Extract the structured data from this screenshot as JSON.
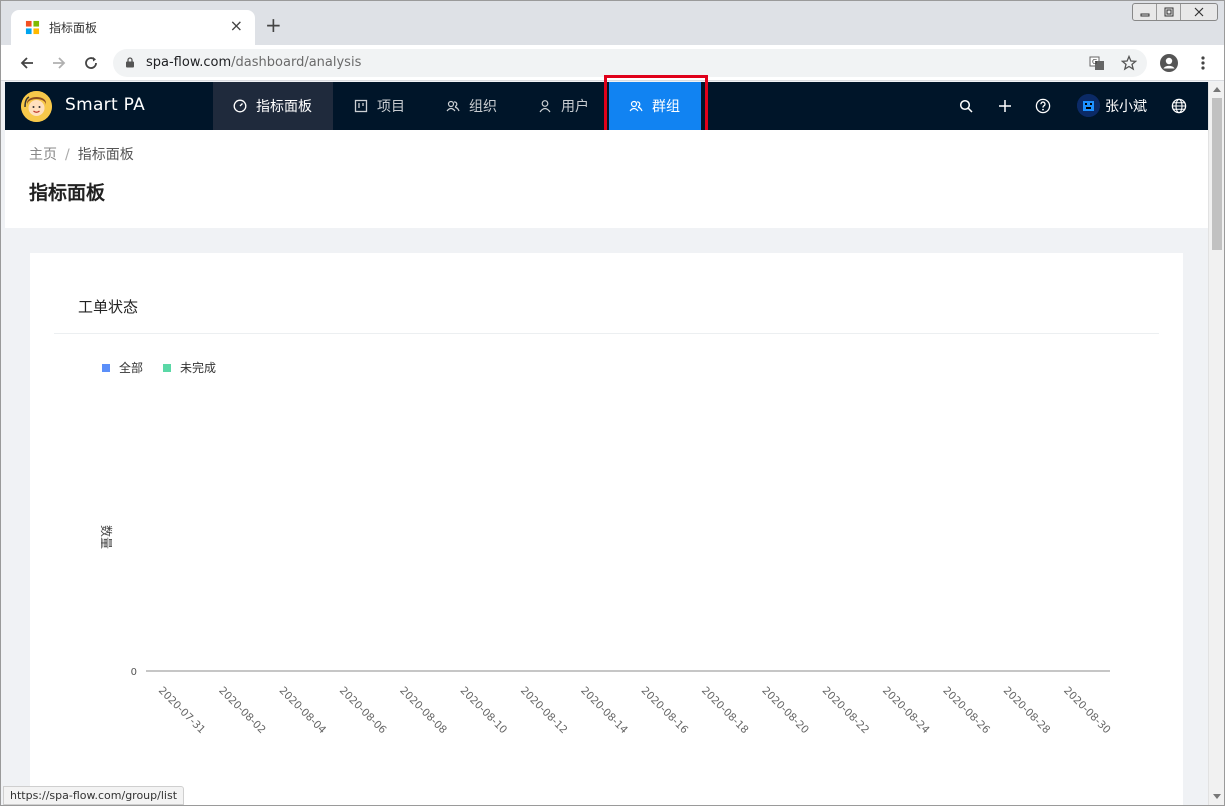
{
  "browser": {
    "tab_title": "指标面板",
    "url_host": "spa-flow.com",
    "url_path": "/dashboard/analysis",
    "status_url": "https://spa-flow.com/group/list"
  },
  "app": {
    "brand": "Smart PA",
    "nav": {
      "dashboard": "指标面板",
      "projects": "项目",
      "orgs": "组织",
      "users": "用户",
      "groups": "群组"
    },
    "username": "张小斌",
    "colors": {
      "nav_bg": "#001529",
      "selected": "#1183f2",
      "highlight_border": "#e0001a"
    }
  },
  "page": {
    "breadcrumb_home": "主页",
    "breadcrumb_sep": "/",
    "breadcrumb_current": "指标面板",
    "title": "指标面板"
  },
  "card": {
    "title": "工单状态",
    "legend": [
      {
        "label": "全部",
        "color": "#5b8ff9"
      },
      {
        "label": "未完成",
        "color": "#5ad8a6"
      }
    ]
  },
  "chart_data": {
    "type": "line",
    "ylabel": "数量",
    "yticks": [
      "0"
    ],
    "x": [
      "2020-07-31",
      "2020-08-02",
      "2020-08-04",
      "2020-08-06",
      "2020-08-08",
      "2020-08-10",
      "2020-08-12",
      "2020-08-14",
      "2020-08-16",
      "2020-08-18",
      "2020-08-20",
      "2020-08-22",
      "2020-08-24",
      "2020-08-26",
      "2020-08-28",
      "2020-08-30"
    ],
    "series": [
      {
        "name": "全部",
        "values": []
      },
      {
        "name": "未完成",
        "values": []
      }
    ],
    "grid": false,
    "legend_position": "top-left"
  }
}
